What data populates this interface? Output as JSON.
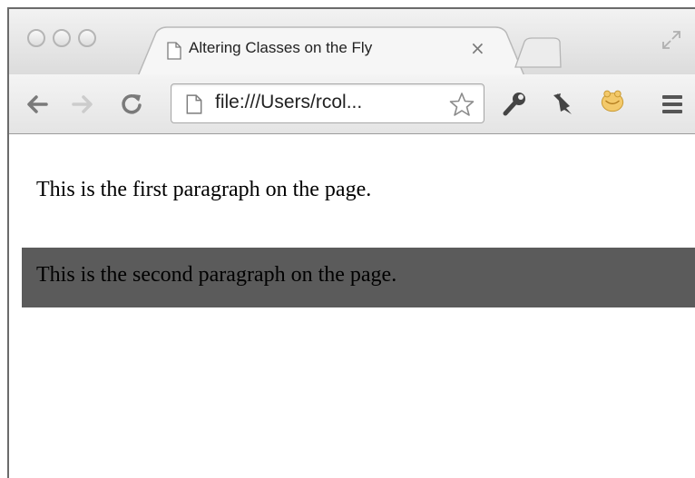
{
  "browser": {
    "tab": {
      "title": "Altering Classes on the Fly",
      "close_glyph": "×",
      "icon": "page-icon"
    },
    "address_bar": {
      "value": "file:///Users/rcol..."
    },
    "toolbar_icons": [
      "back-arrow-icon",
      "forward-arrow-icon",
      "reload-icon",
      "page-icon",
      "star-icon",
      "wrench-icon",
      "pin-icon",
      "extension-icon",
      "menu-icon"
    ]
  },
  "page": {
    "paragraphs": [
      "This is the first paragraph on the page.",
      "This is the second paragraph on the page."
    ],
    "highlight_color": "#5b5b5b"
  }
}
